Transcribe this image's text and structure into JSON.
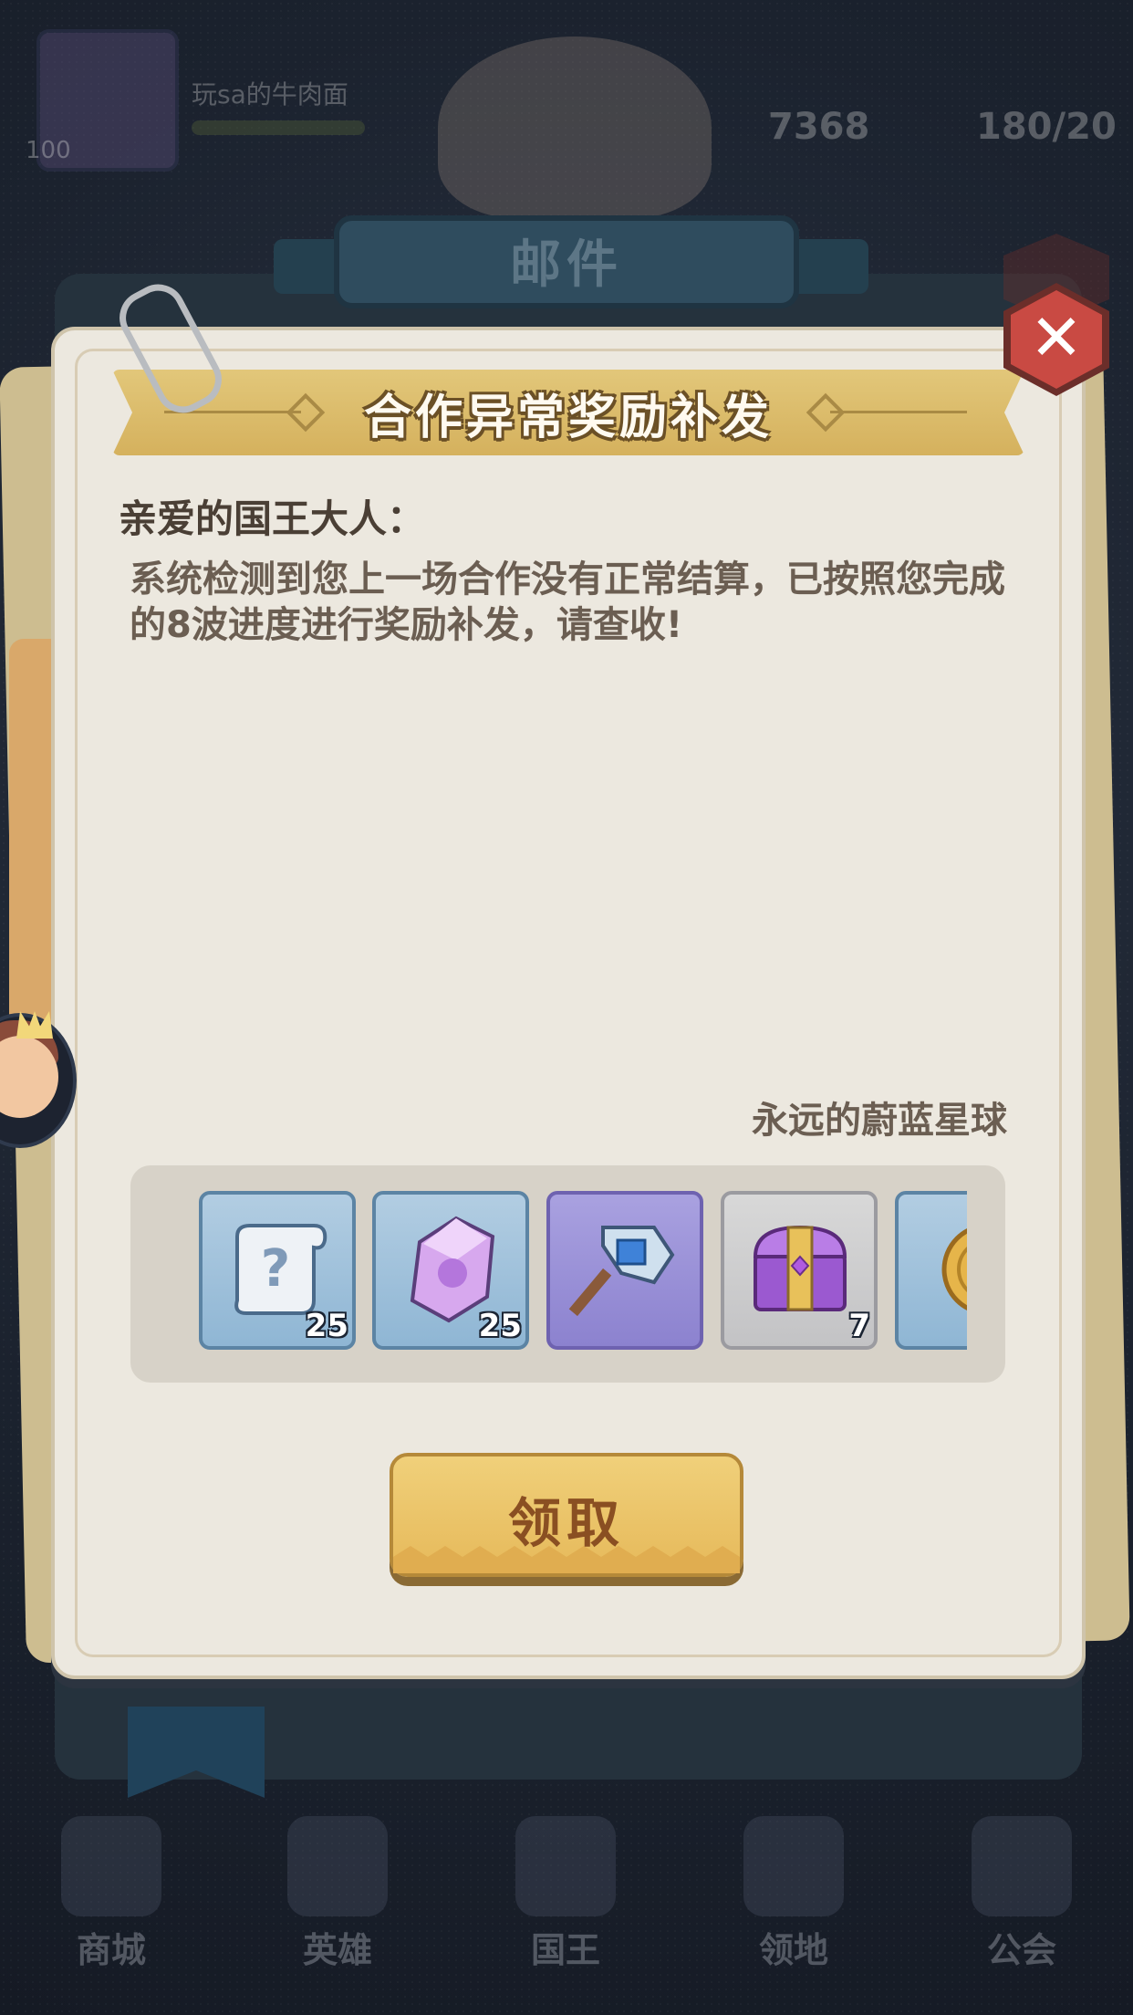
{
  "background_hud": {
    "player_level": "100",
    "player_name": "玩sa的牛肉面",
    "coins": "7368",
    "energy": "180/20",
    "nav": [
      "商城",
      "英雄",
      "国王",
      "领地",
      "公会"
    ]
  },
  "mail_tab": {
    "title": "邮件"
  },
  "mail": {
    "title": "合作异常奖励补发",
    "greeting": "亲爱的国王大人：",
    "body": "系统检测到您上一场合作没有正常结算，已按照您完成的8波进度进行奖励补发，请查收!",
    "sender": "永远的蔚蓝星球"
  },
  "rewards": [
    {
      "icon": "mystery-scroll-icon",
      "rarity": "blue",
      "count": "25"
    },
    {
      "icon": "purple-crystal-icon",
      "rarity": "blue",
      "count": "25"
    },
    {
      "icon": "hammer-icon",
      "rarity": "purple",
      "count": ""
    },
    {
      "icon": "treasure-chest-icon",
      "rarity": "gray",
      "count": "7"
    },
    {
      "icon": "gold-coin-icon",
      "rarity": "blue",
      "count": ""
    }
  ],
  "claim_button": {
    "label": "领取"
  },
  "close_button": {
    "label": "✕"
  },
  "colors": {
    "banner": "#d5b15d",
    "claim": "#e6b95a",
    "close": "#c94a43",
    "paper": "#ece8df"
  }
}
